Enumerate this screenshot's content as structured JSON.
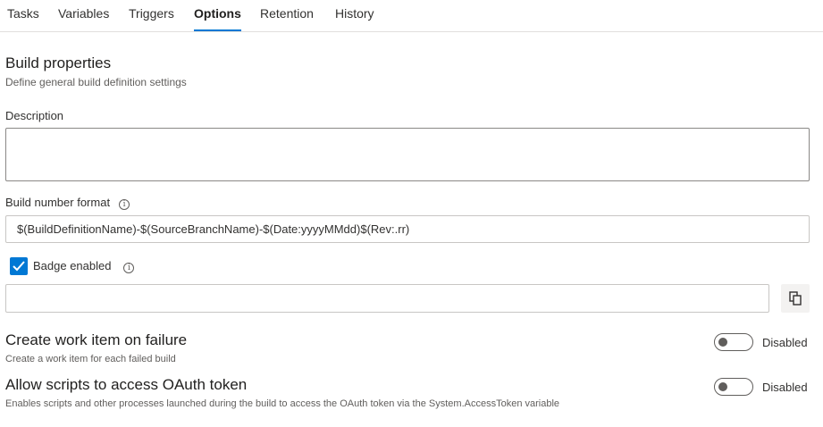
{
  "tabs": [
    {
      "label": "Tasks",
      "active": false
    },
    {
      "label": "Variables",
      "active": false
    },
    {
      "label": "Triggers",
      "active": false
    },
    {
      "label": "Options",
      "active": true
    },
    {
      "label": "Retention",
      "active": false
    },
    {
      "label": "History",
      "active": false
    }
  ],
  "section": {
    "title": "Build properties",
    "subtitle": "Define general build definition settings"
  },
  "description": {
    "label": "Description",
    "value": ""
  },
  "build_number": {
    "label": "Build number format",
    "value": "$(BuildDefinitionName)-$(SourceBranchName)-$(Date:yyyyMMdd)$(Rev:.rr)"
  },
  "badge": {
    "label": "Badge enabled",
    "checked": true,
    "url": ""
  },
  "options": [
    {
      "title": "Create work item on failure",
      "description": "Create a work item for each failed build",
      "state": "Disabled",
      "enabled": false
    },
    {
      "title": "Allow scripts to access OAuth token",
      "description": "Enables scripts and other processes launched during the build to access the OAuth token via the System.AccessToken variable",
      "state": "Disabled",
      "enabled": false
    }
  ],
  "colors": {
    "accent": "#0078d4"
  }
}
